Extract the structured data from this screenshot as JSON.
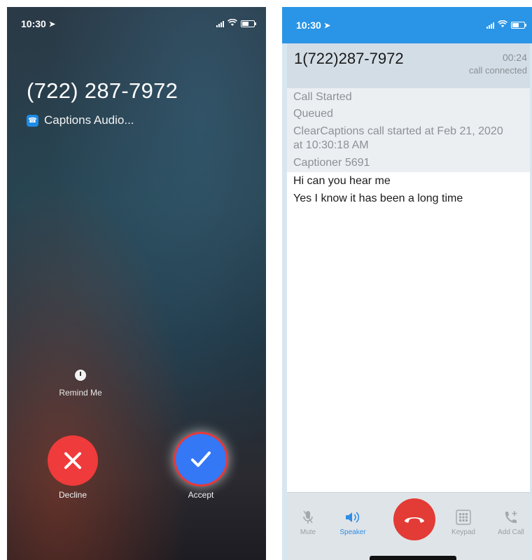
{
  "incoming_call": {
    "status_bar": {
      "time": "10:30"
    },
    "caller_number": "(722) 287-7972",
    "app_name": "Captions Audio...",
    "remind_label": "Remind Me",
    "decline_label": "Decline",
    "accept_label": "Accept",
    "colors": {
      "decline": "#ef3b3b",
      "accept": "#3478f6"
    }
  },
  "caption_call": {
    "status_bar": {
      "time": "10:30"
    },
    "caller_number": "1(722)287-7972",
    "timer": "00:24",
    "status": "call connected",
    "log": [
      "Call Started",
      "Queued",
      "ClearCaptions call started at Feb 21, 2020",
      "at 10:30:18 AM",
      "Captioner 5691"
    ],
    "transcript": [
      "Hi can you hear me",
      "Yes I know it has been a long time"
    ],
    "toolbar": {
      "mute": "Mute",
      "speaker": "Speaker",
      "keypad": "Keypad",
      "add_call": "Add Call"
    },
    "colors": {
      "header_blue": "#2a95e6",
      "end_call": "#e33b35",
      "speaker_active": "#2f8de4"
    }
  }
}
